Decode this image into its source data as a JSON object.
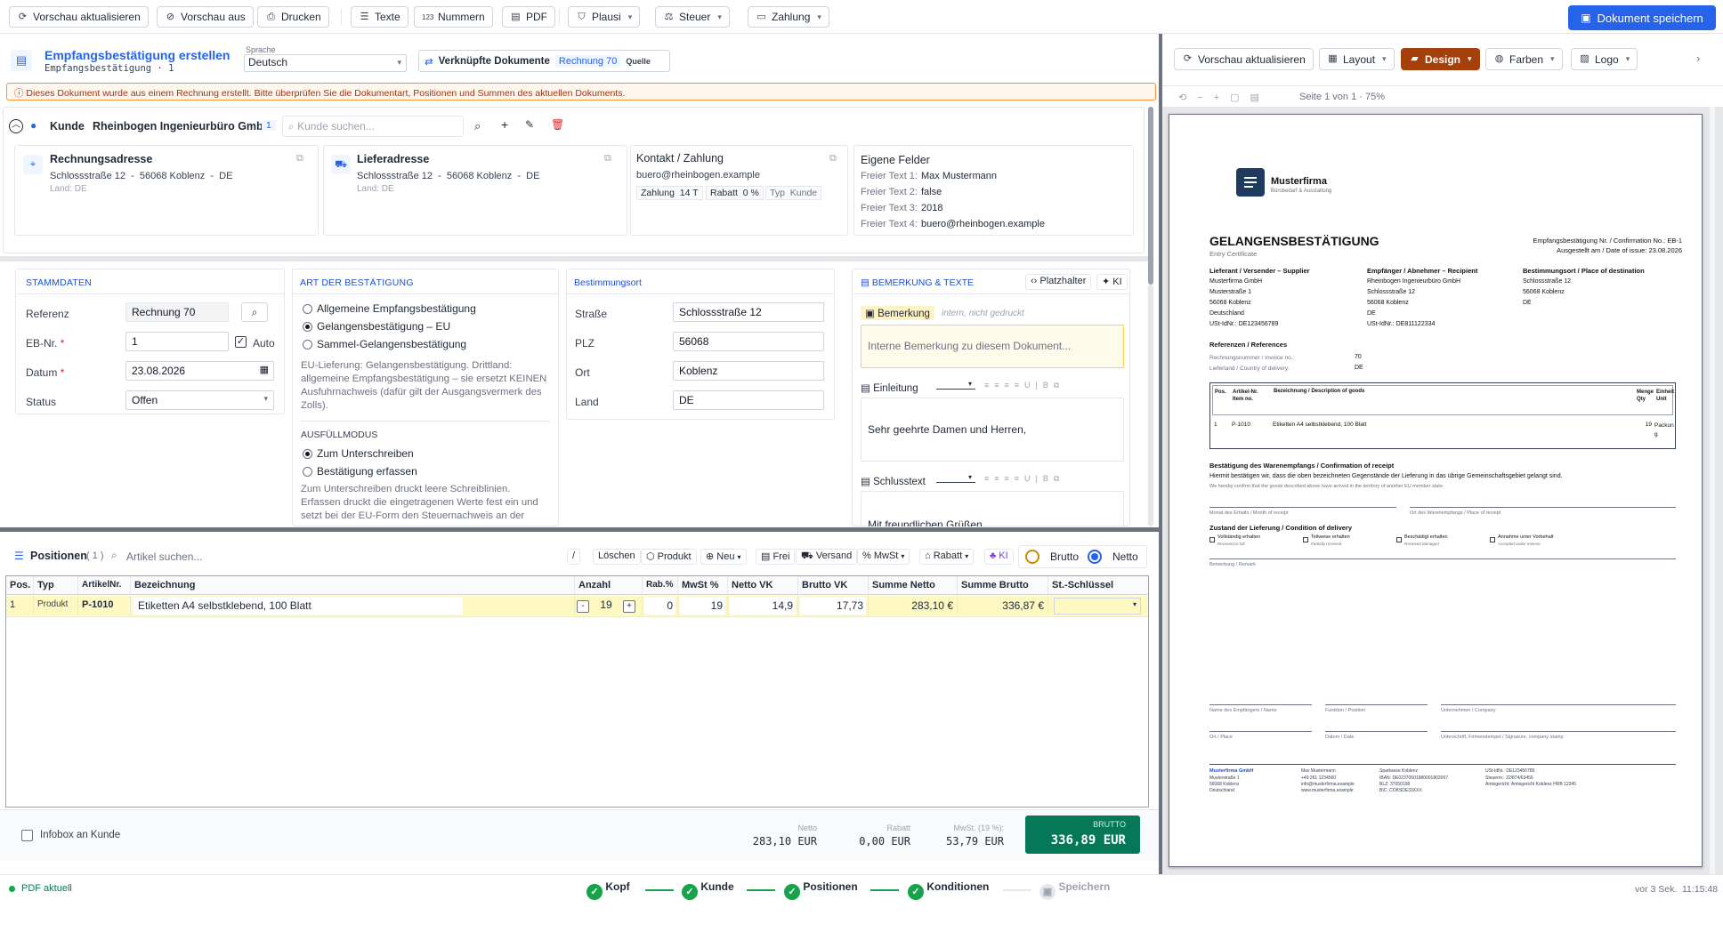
{
  "toolbar": {
    "refresh": "Vorschau aktualisieren",
    "hide_preview": "Vorschau aus",
    "print": "Drucken",
    "texts": "Texte",
    "numbers": "Nummern",
    "pdf": "PDF",
    "plausi": "Plausi",
    "tax": "Steuer",
    "payment": "Zahlung",
    "save": "Dokument speichern"
  },
  "doc": {
    "title": "Empfangsbestätigung erstellen",
    "subtitle": "Empfangsbestätigung · 1",
    "lang_label": "Sprache",
    "lang_value": "Deutsch",
    "linked_label": "Verknüpfte Dokumente",
    "linked_value": "Rechnung 70",
    "linked_source": "Quelle"
  },
  "warning": "Dieses Dokument wurde aus einem Rechnung erstellt. Bitte überprüfen Sie die Dokumentart, Positionen und Summen des aktuellen Dokuments.",
  "customer": {
    "label": "Kunde",
    "name": "Rheinbogen Ingenieurbüro GmbH",
    "badge": "1",
    "search_placeholder": "Kunde suchen...",
    "billing": {
      "title": "Rechnungsadresse",
      "address": "Schlossstraße 12  -  56068 Koblenz  -  DE",
      "country": "Land: DE"
    },
    "delivery": {
      "title": "Lieferadresse",
      "address": "Schlossstraße 12  -  56068 Koblenz  -  DE",
      "country": "Land: DE"
    },
    "contact": {
      "title": "Kontakt / Zahlung",
      "email": "buero@rheinbogen.example",
      "payment": "Zahlung  14 T",
      "discount": "Rabatt  0 %",
      "type": "Typ  Kunde"
    },
    "custom": {
      "title": "Eigene Felder",
      "fields": [
        {
          "label": "Freier Text 1:",
          "value": "Max Mustermann"
        },
        {
          "label": "Freier Text 2:",
          "value": "false"
        },
        {
          "label": "Freier Text 3:",
          "value": "2018"
        },
        {
          "label": "Freier Text 4:",
          "value": "buero@rheinbogen.example"
        }
      ]
    }
  },
  "master": {
    "title": "STAMMDATEN",
    "ref_label": "Referenz",
    "ref_value": "Rechnung 70",
    "eb_label": "EB-Nr.",
    "eb_value": "1",
    "auto": "Auto",
    "date_label": "Datum",
    "date_value": "23.08.2026",
    "status_label": "Status",
    "status_value": "Offen"
  },
  "type": {
    "title": "ART DER BESTÄTIGUNG",
    "options": [
      "Allgemeine Empfangsbestätigung",
      "Gelangensbestätigung – EU",
      "Sammel-Gelangensbestätigung"
    ],
    "selected": 1,
    "hint": "EU-Lieferung: Gelangensbestätigung. Drittland: allgemeine Empfangsbestätigung – sie ersetzt KEINEN Ausfuhrnachweis (dafür gilt der Ausgangsvermerk des Zolls).",
    "fill_title": "AUSFÜLLMODUS",
    "fill_options": [
      "Zum Unterschreiben",
      "Bestätigung erfassen"
    ],
    "fill_hint": "Zum Unterschreiben druckt leere Schreiblinien. Erfassen druckt die eingetragenen Werte fest ein und setzt bei der EU-Form den Steuernachweis an der"
  },
  "destination": {
    "title": "Bestimmungsort",
    "street_label": "Straße",
    "street": "Schlossstraße 12",
    "zip_label": "PLZ",
    "zip": "56068",
    "city_label": "Ort",
    "city": "Koblenz",
    "country_label": "Land",
    "country": "DE"
  },
  "remarks": {
    "title": "BEMERKUNG & TEXTE",
    "placeholder_btn": "Platzhalter",
    "ai_btn": "KI",
    "remark_label": "Bemerkung",
    "remark_note": "intern, nicht gedruckt",
    "remark_placeholder": "Interne Bemerkung zu diesem Dokument...",
    "intro_label": "Einleitung",
    "intro_text": "Sehr geehrte Damen und Herren,",
    "closing_label": "Schlusstext",
    "closing_text": "Mit freundlichen Grüßen"
  },
  "positions": {
    "title": "Positionen",
    "count": "( 1 )",
    "search_placeholder": "Artikel suchen...",
    "slash": "/",
    "buttons": [
      "Löschen",
      "Produkt",
      "Neu",
      "Frei",
      "Versand",
      "MwSt",
      "Rabatt",
      "KI"
    ],
    "gross": "Brutto",
    "net": "Netto",
    "headers": [
      "Pos.",
      "Typ",
      "ArtikelNr.",
      "Bezeichnung",
      "Anzahl",
      "Rab.%",
      "MwSt %",
      "Netto VK",
      "Brutto VK",
      "Summe Netto",
      "Summe Brutto",
      "St.-Schlüssel"
    ],
    "rows": [
      {
        "pos": "1",
        "type": "Produkt",
        "article": "P-1010",
        "desc": "Etiketten A4 selbstklebend, 100 Blatt",
        "qty": "19",
        "discount": "0",
        "vat": "19",
        "net": "14,9",
        "gross": "17,73",
        "sum_net": "283,10 €",
        "sum_gross": "336,87 €"
      }
    ]
  },
  "footer": {
    "infobox": "Infobox an Kunde",
    "net_label": "Netto",
    "net_value": "283,10 EUR",
    "discount_label": "Rabatt",
    "discount_value": "0,00 EUR",
    "vat_label": "MwSt. (19 %):",
    "vat_value": "53,79 EUR",
    "gross_label": "BRUTTO",
    "gross_value": "336,89 EUR"
  },
  "preview": {
    "refresh": "Vorschau aktualisieren",
    "layout": "Layout",
    "design": "Design",
    "colors": "Farben",
    "logo": "Logo",
    "page_info": "Seite 1 von 1 · 75%"
  },
  "paper": {
    "company": "Musterfirma",
    "company_sub": "Bürobedarf & Ausstattung",
    "heading": "GELANGENSBESTÄTIGUNG",
    "heading_sub": "Entry Certificate",
    "doc_no": "Empfangsbestätigung Nr. / Confirmation No.: EB-1",
    "issue": "Ausgestellt am / Date of issue: 23.08.2026",
    "col1_title": "Lieferant / Versender – Supplier",
    "col1": [
      "Musterfirma GmbH",
      "Musterstraße 1",
      "56068 Koblenz",
      "Deutschland",
      "USt-IdNr.: DE123456789"
    ],
    "col2_title": "Empfänger / Abnehmer – Recipient",
    "col2": [
      "Rheinbogen Ingenieurbüro GmbH",
      "Schlossstraße 12",
      "56068 Koblenz",
      "DE",
      "USt-IdNr.: DE811122334"
    ],
    "col3_title": "Bestimmungsort / Place of destination",
    "col3": [
      "Schlossstraße 12",
      "56068 Koblenz",
      "DE"
    ],
    "refs_title": "Referenzen / References",
    "ref_invoice_label": "Rechnungsnummer / Invoice no.:",
    "ref_invoice": "70",
    "ref_country_label": "Lieferland / Country of delivery:",
    "ref_country": "DE",
    "th_pos": "Pos.",
    "th_art": "Artikel-Nr. Item no.",
    "th_desc": "Bezeichnung / Description of goods",
    "th_qty": "Menge Qty",
    "th_unit": "Einheit Unit",
    "row_pos": "1",
    "row_art": "P-1010",
    "row_desc": "Etiketten A4 selbstklebend, 100 Blatt",
    "row_qty": "19",
    "row_unit": "Packung",
    "confirm_title": "Bestätigung des Warenempfangs / Confirmation of receipt",
    "confirm_de": "Hiermit bestätigen wir, dass die oben bezeichneten Gegenstände der Lieferung in das übrige Gemeinschaftsgebiet gelangt sind.",
    "confirm_en": "We hereby confirm that the goods described above have arrived in the territory of another EU member state.",
    "sig_month": "Monat des Erhalts / Month of receipt",
    "sig_place": "Ort des Warenempfangs / Place of receipt",
    "cond_title": "Zustand der Lieferung / Condition of delivery",
    "conds": [
      {
        "de": "Vollständig erhalten",
        "en": "Received in full"
      },
      {
        "de": "Teilweise erhalten",
        "en": "Partially received"
      },
      {
        "de": "Beschädigt erhalten",
        "en": "Received damaged"
      },
      {
        "de": "Annahme unter Vorbehalt",
        "en": "Accepted under reserve"
      }
    ],
    "remark": "Bemerkung / Remark",
    "sign1": "Name des Empfängers / Name",
    "sign2": "Funktion / Position",
    "sign3": "Unternehmen / Company",
    "sign4": "Ort / Place",
    "sign5": "Datum / Date",
    "sign6": "Unterschrift, Firmenstempel / Signature, company stamp",
    "foot1": [
      "Musterfirma GmbH",
      "Musterstraße 1",
      "56068 Koblenz",
      "Deutschland"
    ],
    "foot2": [
      "Max Mustermann",
      "+49 261 1234560",
      "info@musterfirma.example",
      "www.musterfirma.example"
    ],
    "foot3": [
      "Sparkasse Koblenz",
      "IBAN: DE02370501980001802057",
      "BLZ: 37050198",
      "BIC: COKSDE33XXX"
    ],
    "foot4": [
      "USt-IdNr.: DE123456789",
      "Steuernr.: 22/874/63456",
      "Amtsgericht: Amtsgericht Koblenz HRB 12345"
    ]
  },
  "statusbar": {
    "pdf": "PDF aktuell",
    "steps": [
      "Kopf",
      "Kunde",
      "Positionen",
      "Konditionen",
      "Speichern"
    ],
    "time_ago": "vor 3 Sek.",
    "clock": "11:15:48"
  }
}
